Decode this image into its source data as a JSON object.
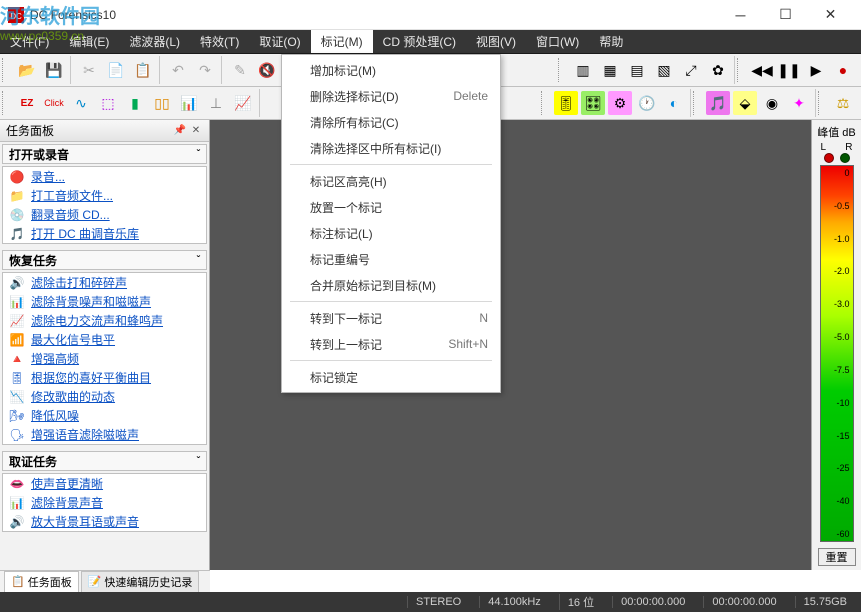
{
  "title": "DC Forensics10",
  "watermark": {
    "line1": "河东软件园",
    "line2": "www.pc0359.cn"
  },
  "menu": [
    {
      "label": "文件(F)"
    },
    {
      "label": "编辑(E)"
    },
    {
      "label": "滤波器(L)"
    },
    {
      "label": "特效(T)"
    },
    {
      "label": "取证(O)"
    },
    {
      "label": "标记(M)",
      "active": true
    },
    {
      "label": "CD 预处理(C)"
    },
    {
      "label": "视图(V)"
    },
    {
      "label": "窗口(W)"
    },
    {
      "label": "帮助"
    }
  ],
  "dropdown": {
    "groups": [
      [
        {
          "label": "增加标记(M)"
        },
        {
          "label": "删除选择标记(D)",
          "shortcut": "Delete"
        },
        {
          "label": "清除所有标记(C)"
        },
        {
          "label": "清除选择区中所有标记(I)"
        }
      ],
      [
        {
          "label": "标记区高亮(H)"
        },
        {
          "label": "放置一个标记"
        },
        {
          "label": "标注标记(L)"
        },
        {
          "label": "标记重编号"
        },
        {
          "label": "合并原始标记到目标(M)"
        }
      ],
      [
        {
          "label": "转到下一标记",
          "shortcut": "N"
        },
        {
          "label": "转到上一标记",
          "shortcut": "Shift+N"
        }
      ],
      [
        {
          "label": "标记锁定"
        }
      ]
    ]
  },
  "taskpanel": {
    "title": "任务面板",
    "sections": [
      {
        "heading": "打开或录音",
        "items": [
          {
            "icon": "🔴",
            "label": "录音..."
          },
          {
            "icon": "📁",
            "label": "打工音频文件..."
          },
          {
            "icon": "💿",
            "label": "翻录音频 CD..."
          },
          {
            "icon": "🎵",
            "label": "打开 DC 曲调音乐库"
          }
        ]
      },
      {
        "heading": "恢复任务",
        "items": [
          {
            "icon": "🔊",
            "label": "滤除击打和碎碎声"
          },
          {
            "icon": "📊",
            "label": "滤除背景噪声和嗞嗞声"
          },
          {
            "icon": "📈",
            "label": "滤除电力交流声和蜂鸣声"
          },
          {
            "icon": "📶",
            "label": "最大化信号电平"
          },
          {
            "icon": "🔺",
            "label": "增强高频"
          },
          {
            "icon": "🎚",
            "label": "根据您的喜好平衡曲目"
          },
          {
            "icon": "📉",
            "label": "修改歌曲的动态"
          },
          {
            "icon": "🌬",
            "label": "降低风噪"
          },
          {
            "icon": "🗣",
            "label": "增强语音滤除嗞嗞声"
          }
        ]
      },
      {
        "heading": "取证任务",
        "items": [
          {
            "icon": "👄",
            "label": "使声音更清晰"
          },
          {
            "icon": "📊",
            "label": "滤除背景声音"
          },
          {
            "icon": "🔊",
            "label": "放大背景耳语或声音"
          }
        ]
      }
    ]
  },
  "bottomtabs": [
    {
      "label": "任务面板",
      "icon": "📋",
      "active": true
    },
    {
      "label": "快速编辑历史记录",
      "icon": "📝",
      "active": false
    }
  ],
  "meter": {
    "title": "峰值 dB",
    "left": "L",
    "right": "R",
    "ticks": [
      "0",
      "-0.5",
      "-1.0",
      "-2.0",
      "-3.0",
      "-5.0",
      "-7.5",
      "-10",
      "-15",
      "-25",
      "-40",
      "-60"
    ],
    "reset": "重置"
  },
  "status": {
    "stereo": "STEREO",
    "rate": "44.100kHz",
    "bits": "16 位",
    "time1": "00:00:00.000",
    "time2": "00:00:00.000",
    "disk": "15.75GB"
  },
  "colors": {
    "menubg": "#363636",
    "workspace": "#555555",
    "link": "#0b51c4"
  }
}
